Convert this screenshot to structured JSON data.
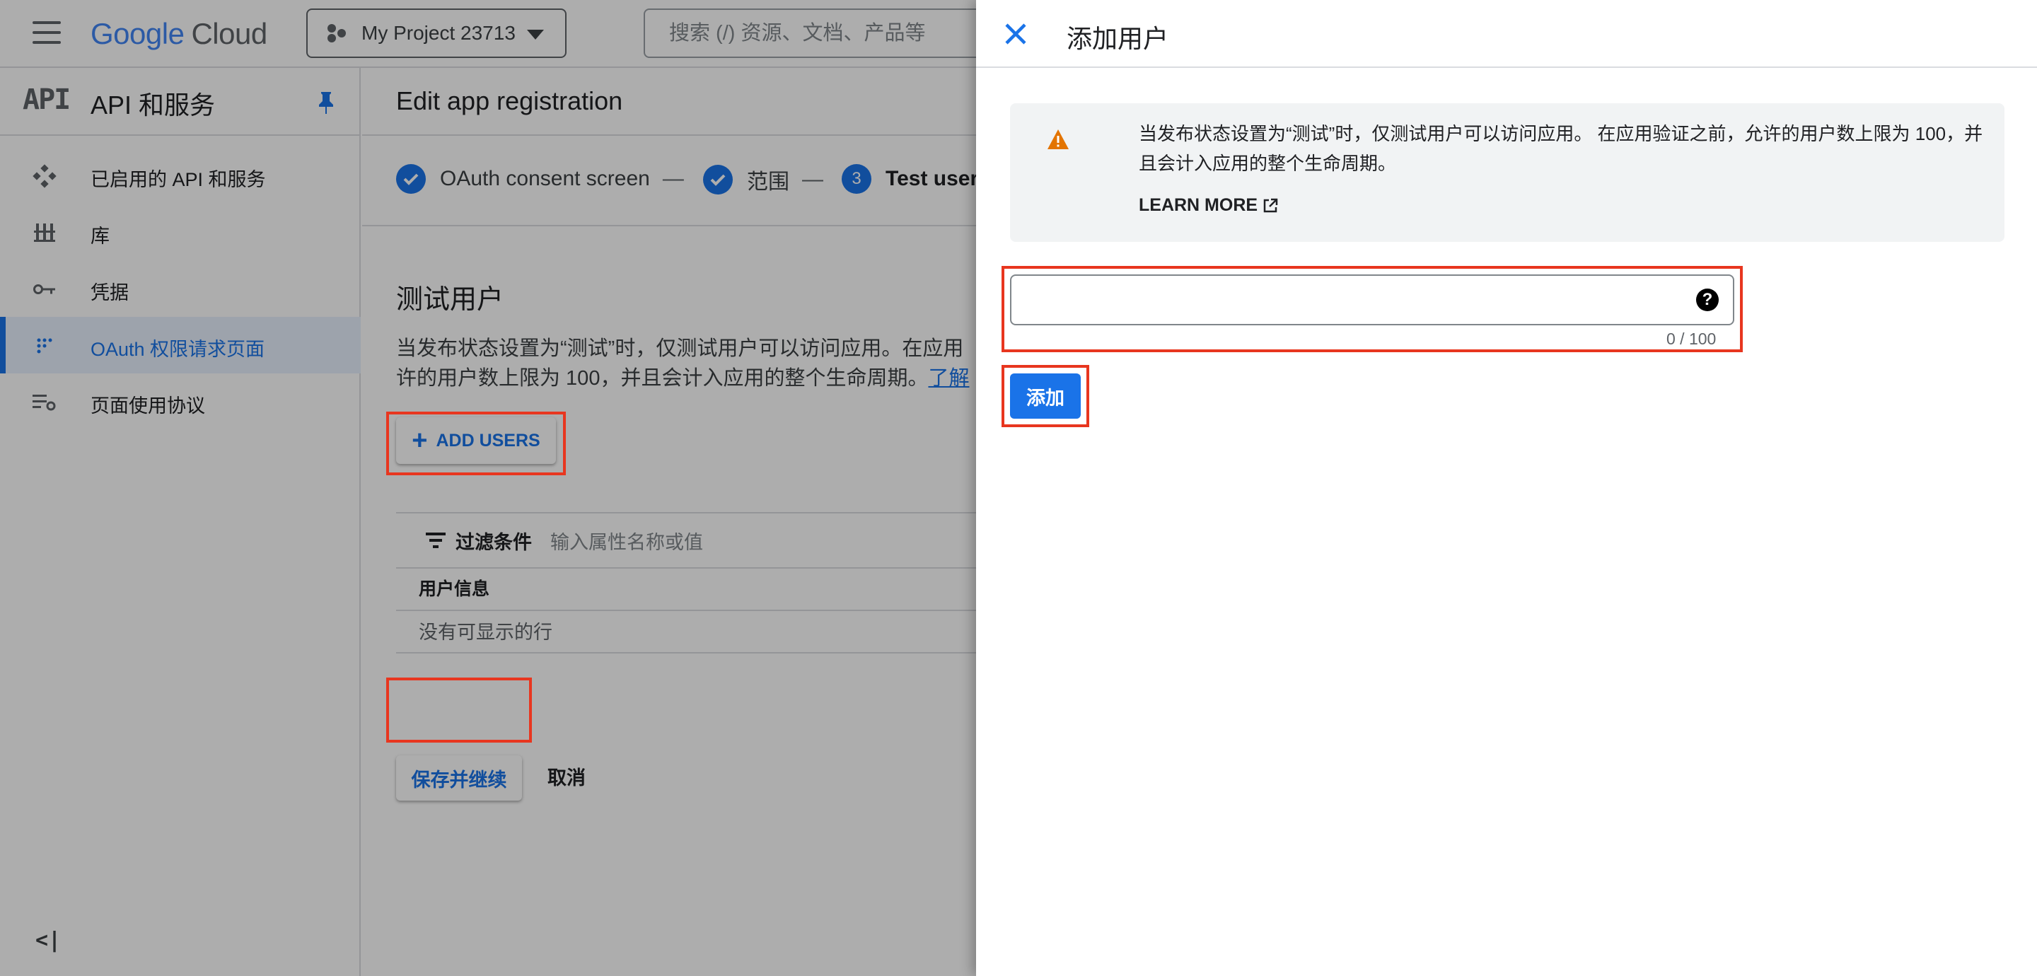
{
  "topbar": {
    "logo_google": "Google",
    "logo_cloud": "Cloud",
    "project_name": "My Project 23713",
    "search_placeholder": "搜索 (/) 资源、文档、产品等"
  },
  "sidebar": {
    "logo_text": "API",
    "title": "API 和服务",
    "items": [
      {
        "label": "已启用的 API 和服务",
        "icon": "diamond-grid-icon",
        "active": false
      },
      {
        "label": "库",
        "icon": "library-icon",
        "active": false
      },
      {
        "label": "凭据",
        "icon": "key-icon",
        "active": false
      },
      {
        "label": "OAuth 权限请求页面",
        "icon": "dots-grid-icon",
        "active": true
      },
      {
        "label": "页面使用协议",
        "icon": "settings-list-icon",
        "active": false
      }
    ],
    "collapse_glyph": "<|"
  },
  "main": {
    "page_title": "Edit app registration",
    "steps": [
      {
        "label": "OAuth consent screen",
        "state": "done",
        "separator": "—"
      },
      {
        "label": "范围",
        "state": "done",
        "separator": "—"
      },
      {
        "label": "Test user",
        "state": "current",
        "number": "3",
        "separator": ""
      }
    ],
    "section_title": "测试用户",
    "description": "当发布状态设置为“测试”时，仅测试用户可以访问应用。在应用",
    "description_line2": "许的用户数上限为 100，并且会计入应用的整个生命周期。",
    "learn_link": "了解",
    "add_users_label": "ADD USERS",
    "filter_label": "过滤条件",
    "filter_placeholder": "输入属性名称或值",
    "table_header": "用户信息",
    "table_empty": "没有可显示的行",
    "save_label": "保存并继续",
    "cancel_label": "取消"
  },
  "drawer": {
    "title": "添加用户",
    "alert_message": "当发布状态设置为“测试”时，仅测试用户可以访问应用。 在应用验证之前，允许的用户数上限为 100，并且会计入应用的整个生命周期。",
    "learn_more": "LEARN MORE",
    "input_value": "",
    "help_glyph": "?",
    "counter": "0 / 100",
    "add_label": "添加"
  },
  "colors": {
    "accent": "#1a73e8",
    "highlight": "#e8361f",
    "warning": "#e37400"
  }
}
